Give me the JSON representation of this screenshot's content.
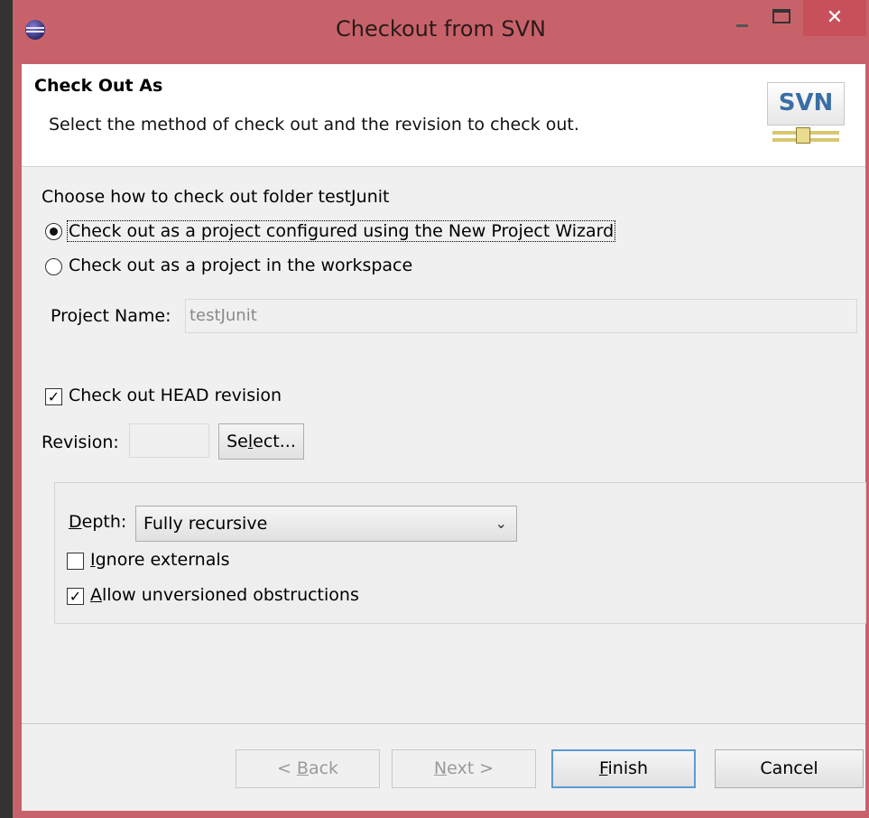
{
  "window": {
    "title": "Checkout from SVN",
    "close_glyph": "✕",
    "icons": [
      "eclipse-icon",
      "minimize-icon",
      "maximize-icon",
      "close-icon"
    ]
  },
  "header": {
    "title": "Check Out As",
    "description": "Select the method of check out and the revision to check out.",
    "logo_text": "SVN"
  },
  "checkout_method": {
    "label": "Choose how to check out folder testJunit",
    "option_wizard": "Check out as a project configured using the New Project Wizard",
    "option_workspace": "Check out as a project in the workspace",
    "selected": "option_wizard"
  },
  "project_name": {
    "label": "Project Name:",
    "value": "testJunit"
  },
  "revision": {
    "head_label": "Check out HEAD revision",
    "head_checked": true,
    "revision_label": "Revision:",
    "revision_value": "",
    "select_pre": "Se",
    "select_u": "l",
    "select_post": "ect..."
  },
  "options": {
    "depth_u": "D",
    "depth_rest": "epth:",
    "depth_value": "Fully recursive",
    "ignore_u": "I",
    "ignore_rest": "gnore externals",
    "ignore_checked": false,
    "allow_u": "A",
    "allow_rest": "llow unversioned obstructions",
    "allow_checked": true
  },
  "buttons": {
    "back_pre": "< ",
    "back_u": "B",
    "back_post": "ack",
    "next_u": "N",
    "next_post": "ext >",
    "finish_u": "F",
    "finish_post": "inish",
    "cancel": "Cancel"
  },
  "colors": {
    "titlebar": "#c8626a",
    "close_button": "#c7505a",
    "dialog_bg": "#f0f0f0",
    "header_bg": "#ffffff",
    "svn_blue": "#3a6ea5"
  }
}
